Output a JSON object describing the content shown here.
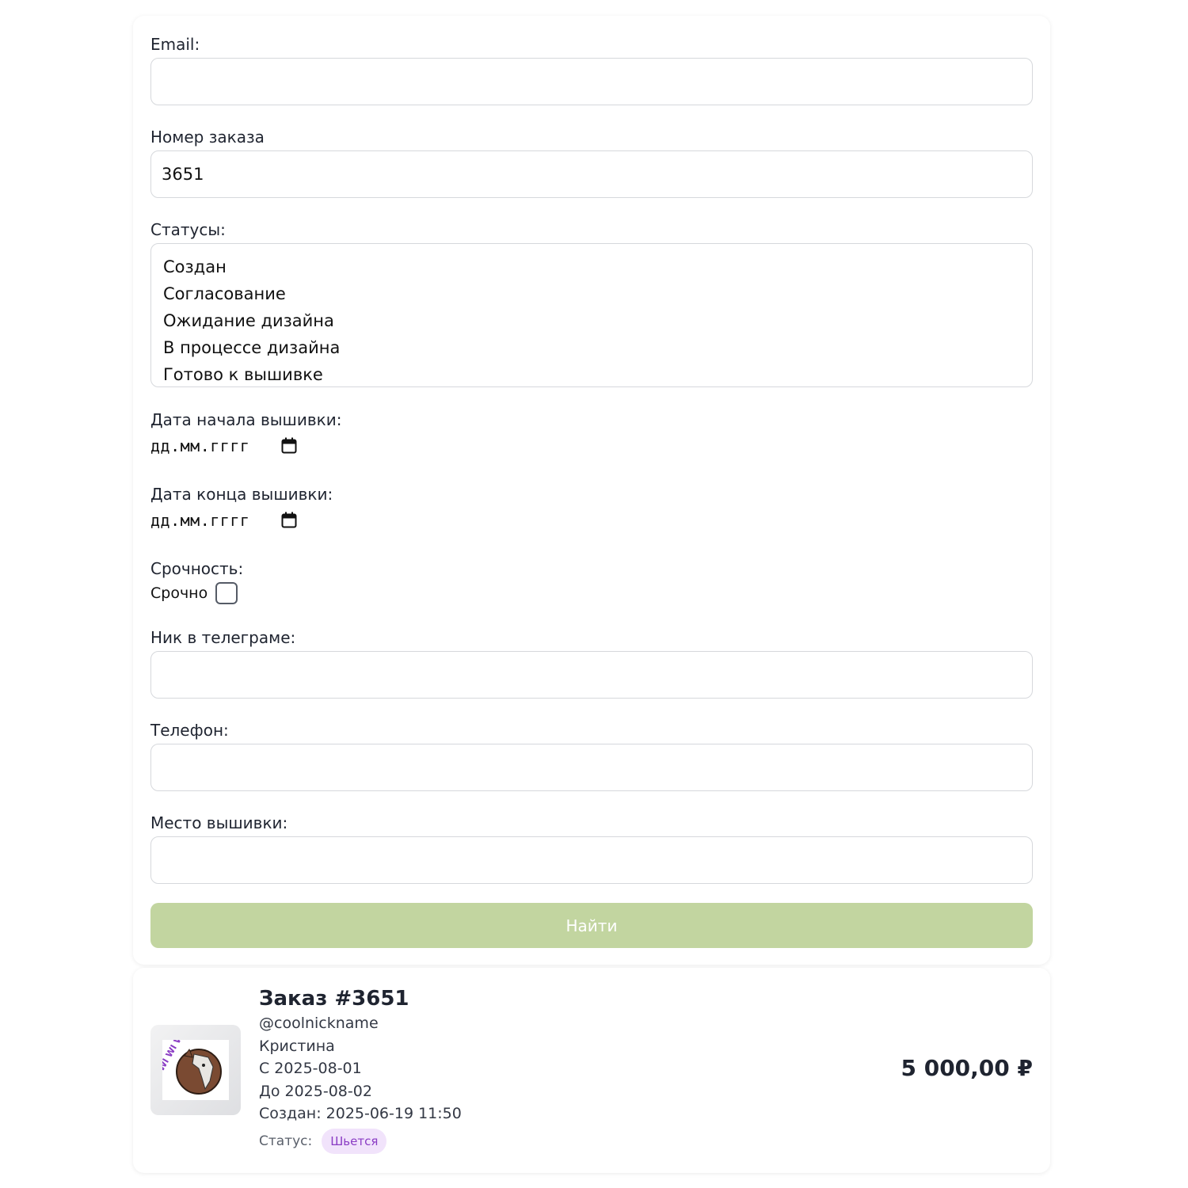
{
  "filters": {
    "email": {
      "label": "Email:",
      "value": ""
    },
    "order_number": {
      "label": "Номер заказа",
      "value": "3651"
    },
    "statuses": {
      "label": "Статусы:",
      "options": [
        "Создан",
        "Согласование",
        "Ожидание дизайна",
        "В процессе дизайна",
        "Готово к вышивке"
      ]
    },
    "start_date": {
      "label": "Дата начала вышивки:",
      "placeholder": "дд.мм.гггг",
      "icon": "calendar-icon"
    },
    "end_date": {
      "label": "Дата конца вышивки:",
      "placeholder": "дд.мм.гггг",
      "icon": "calendar-icon"
    },
    "urgency": {
      "label": "Срочность:",
      "checkbox_label": "Срочно",
      "checked": false
    },
    "telegram": {
      "label": "Ник в телеграме:",
      "value": ""
    },
    "phone": {
      "label": "Телефон:",
      "value": ""
    },
    "place": {
      "label": "Место вышивки:",
      "value": ""
    },
    "submit_label": "Найти"
  },
  "order": {
    "title": "Заказ #3651",
    "telegram": "@coolnickname",
    "name": "Кристина",
    "from": "С 2025-08-01",
    "to": "До 2025-08-02",
    "created": "Создан: 2025-06-19 11:50",
    "status_label": "Статус:",
    "status": "Шьется",
    "price": "5 000,00 ₽",
    "thumbnail_text": "WI WI WI"
  },
  "colors": {
    "button": "#c2d5a0",
    "badge_bg": "#f1e3fb",
    "badge_text": "#8a3cc4"
  }
}
